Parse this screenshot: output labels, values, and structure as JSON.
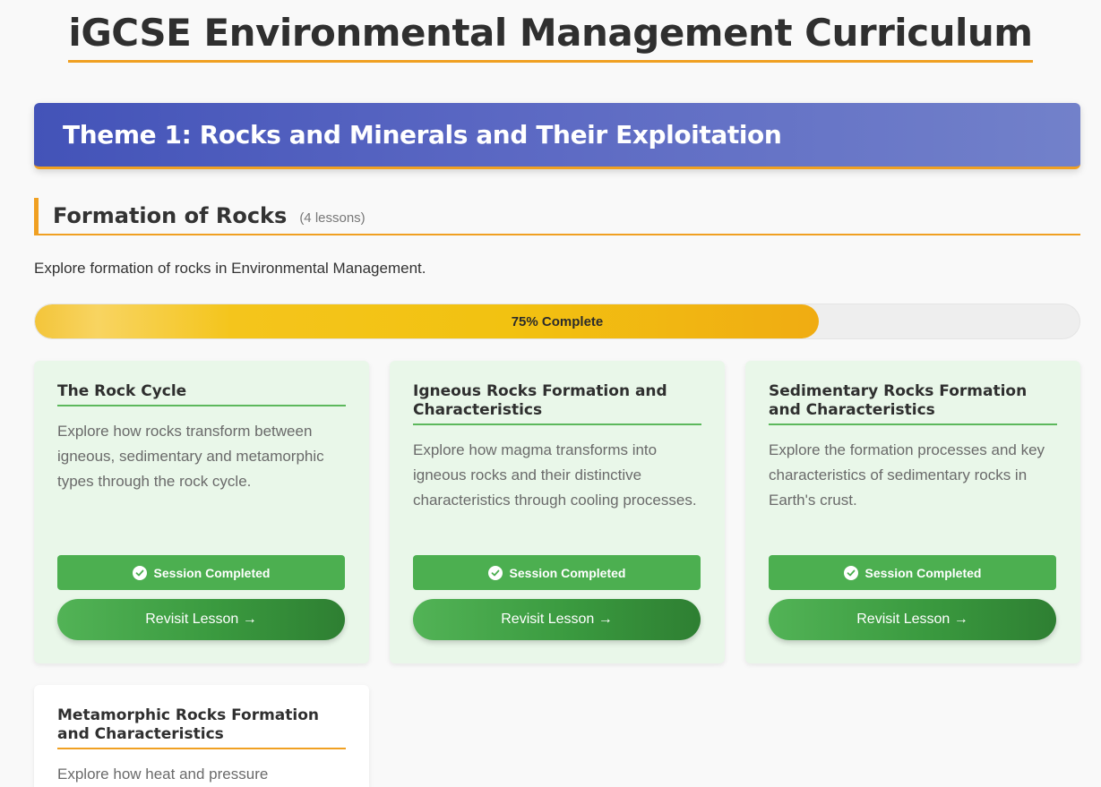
{
  "header": {
    "title": "iGCSE Environmental Management Curriculum"
  },
  "theme": {
    "title": "Theme 1: Rocks and Minerals and Their Exploitation"
  },
  "section": {
    "title": "Formation of Rocks",
    "lesson_count": "(4 lessons)",
    "description": "Explore formation of rocks in Environmental Management.",
    "progress_label": "75% Complete",
    "progress_fraction": 0.75
  },
  "lessons": [
    {
      "title": "The Rock Cycle",
      "description": "Explore how rocks transform between igneous, sedimentary and metamorphic types through the rock cycle.",
      "status": "Session Completed",
      "action": "Revisit Lesson →"
    },
    {
      "title": "Igneous Rocks Formation and Characteristics",
      "description": "Explore how magma transforms into igneous rocks and their distinctive characteristics through cooling processes.",
      "status": "Session Completed",
      "action": "Revisit Lesson →"
    },
    {
      "title": "Sedimentary Rocks Formation and Characteristics",
      "description": "Explore the formation processes and key characteristics of sedimentary rocks in Earth's crust.",
      "status": "Session Completed",
      "action": "Revisit Lesson →"
    },
    {
      "title": "Metamorphic Rocks Formation and Characteristics",
      "description": "Explore how heat and pressure"
    }
  ],
  "colors": {
    "accent_orange": "#f0a022",
    "theme_blue": "#4353b8",
    "completed_green": "#4caf50",
    "card_green_bg": "#e9f7e9"
  },
  "icons": {
    "status": "check-circle-icon"
  }
}
